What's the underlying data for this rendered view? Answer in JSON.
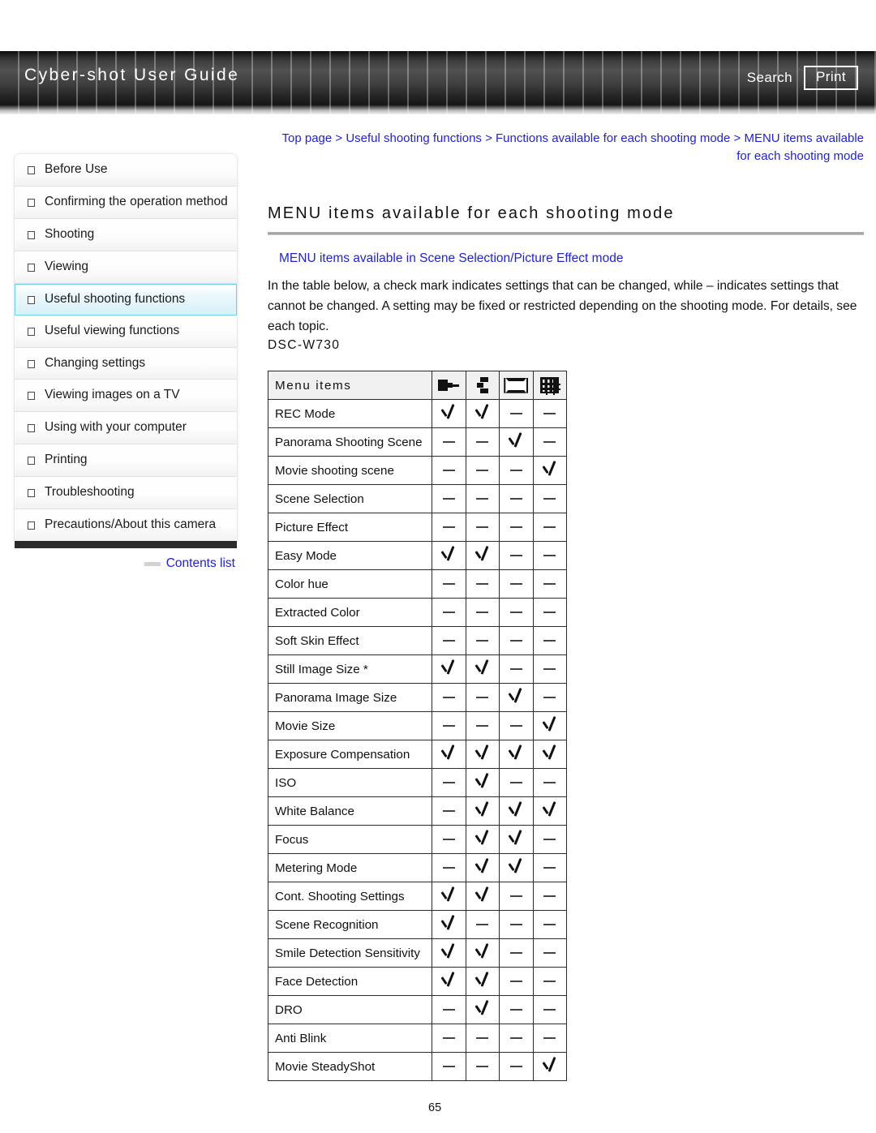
{
  "header": {
    "title": "Cyber-shot User Guide",
    "search_label": "Search",
    "print_label": "Print"
  },
  "sidebar": {
    "items": [
      {
        "label": "Before Use",
        "selected": false
      },
      {
        "label": "Confirming the operation method",
        "selected": false
      },
      {
        "label": "Shooting",
        "selected": false
      },
      {
        "label": "Viewing",
        "selected": false
      },
      {
        "label": "Useful shooting functions",
        "selected": true
      },
      {
        "label": "Useful viewing functions",
        "selected": false
      },
      {
        "label": "Changing settings",
        "selected": false
      },
      {
        "label": "Viewing images on a TV",
        "selected": false
      },
      {
        "label": "Using with your computer",
        "selected": false
      },
      {
        "label": "Printing",
        "selected": false
      },
      {
        "label": "Troubleshooting",
        "selected": false
      },
      {
        "label": "Precautions/About this camera",
        "selected": false
      }
    ],
    "contents_link": "Contents list"
  },
  "main": {
    "breadcrumb": "Top page > Useful shooting functions > Functions available for each shooting mode > MENU items available for each shooting mode",
    "page_title": "MENU items available for each shooting mode",
    "sub_link": "MENU items available in Scene Selection/Picture Effect mode",
    "body_text": "In the table below, a check mark indicates settings that can be changed, while – indicates settings that cannot be changed. A setting may be fixed or restricted depending on the shooting mode. For details, see each topic.",
    "model": "DSC-W730"
  },
  "table": {
    "header_label": "Menu items",
    "columns": [
      {
        "icon": "auto-mode-icon",
        "label": "Intelligent Auto"
      },
      {
        "icon": "program-mode-icon",
        "label": "Program Auto"
      },
      {
        "icon": "panorama-mode-icon",
        "label": "Sweep Panorama"
      },
      {
        "icon": "movie-mode-icon",
        "label": "Movie Mode"
      }
    ],
    "rows": [
      {
        "name": "REC Mode",
        "marks": [
          "check",
          "check",
          "dash",
          "dash"
        ]
      },
      {
        "name": "Panorama Shooting Scene",
        "marks": [
          "dash",
          "dash",
          "check",
          "dash"
        ]
      },
      {
        "name": "Movie shooting scene",
        "marks": [
          "dash",
          "dash",
          "dash",
          "check"
        ]
      },
      {
        "name": "Scene Selection",
        "marks": [
          "dash",
          "dash",
          "dash",
          "dash"
        ]
      },
      {
        "name": "Picture Effect",
        "marks": [
          "dash",
          "dash",
          "dash",
          "dash"
        ]
      },
      {
        "name": "Easy Mode",
        "marks": [
          "check",
          "check",
          "dash",
          "dash"
        ]
      },
      {
        "name": "Color hue",
        "marks": [
          "dash",
          "dash",
          "dash",
          "dash"
        ]
      },
      {
        "name": "Extracted Color",
        "marks": [
          "dash",
          "dash",
          "dash",
          "dash"
        ]
      },
      {
        "name": "Soft Skin Effect",
        "marks": [
          "dash",
          "dash",
          "dash",
          "dash"
        ]
      },
      {
        "name": "Still Image Size *",
        "marks": [
          "check",
          "check",
          "dash",
          "dash"
        ]
      },
      {
        "name": "Panorama Image Size",
        "marks": [
          "dash",
          "dash",
          "check",
          "dash"
        ]
      },
      {
        "name": "Movie Size",
        "marks": [
          "dash",
          "dash",
          "dash",
          "check"
        ]
      },
      {
        "name": "Exposure Compensation",
        "marks": [
          "check",
          "check",
          "check",
          "check"
        ]
      },
      {
        "name": "ISO",
        "marks": [
          "dash",
          "check",
          "dash",
          "dash"
        ]
      },
      {
        "name": "White Balance",
        "marks": [
          "dash",
          "check",
          "check",
          "check"
        ]
      },
      {
        "name": "Focus",
        "marks": [
          "dash",
          "check",
          "check",
          "dash"
        ]
      },
      {
        "name": "Metering Mode",
        "marks": [
          "dash",
          "check",
          "check",
          "dash"
        ]
      },
      {
        "name": "Cont. Shooting Settings",
        "marks": [
          "check",
          "check",
          "dash",
          "dash"
        ]
      },
      {
        "name": "Scene Recognition",
        "marks": [
          "check",
          "dash",
          "dash",
          "dash"
        ]
      },
      {
        "name": "Smile Detection Sensitivity",
        "marks": [
          "check",
          "check",
          "dash",
          "dash"
        ]
      },
      {
        "name": "Face Detection",
        "marks": [
          "check",
          "check",
          "dash",
          "dash"
        ]
      },
      {
        "name": "DRO",
        "marks": [
          "dash",
          "check",
          "dash",
          "dash"
        ]
      },
      {
        "name": "Anti Blink",
        "marks": [
          "dash",
          "dash",
          "dash",
          "dash"
        ]
      },
      {
        "name": "Movie SteadyShot",
        "marks": [
          "dash",
          "dash",
          "dash",
          "check"
        ]
      }
    ]
  },
  "footer": {
    "page_number": "65"
  },
  "colors": {
    "link": "#2222cc",
    "selected_border": "#6fd3e8",
    "header_bar_dark": "#262626"
  }
}
